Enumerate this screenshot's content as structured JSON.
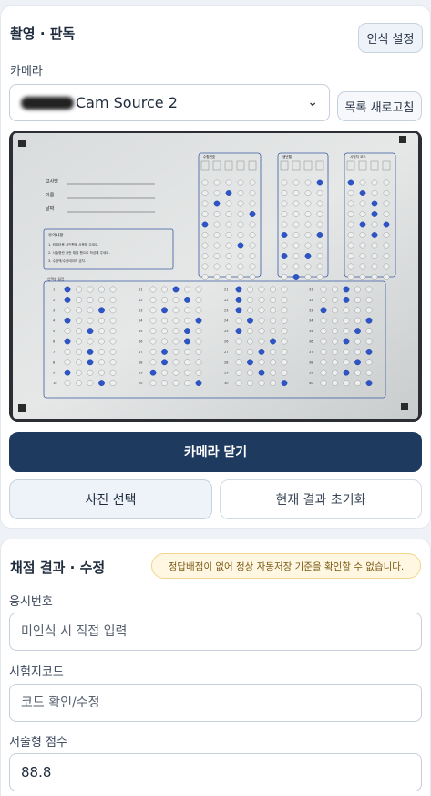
{
  "capture": {
    "title": "촬영 · 판독",
    "recognition_settings": "인식 설정",
    "camera_label": "카메라",
    "camera_selected": "Cam Source 2",
    "refresh_list": "목록 새로고침",
    "close_camera": "카메라 닫기",
    "select_photo": "사진 선택",
    "reset_result": "현재 결과 초기화"
  },
  "omr_sheet": {
    "fields": [
      "고사명",
      "이름",
      "날짜"
    ],
    "notice_title": "유의사항",
    "notice_lines": [
      "1. 컴퓨터용 사인펜을 사용해 주세요.",
      "2. 서술형란 공란 채울 펜으로 작성해 주세요.",
      "3. 수정액/수정테이프 금지."
    ],
    "answers_title": "선택형 답란",
    "section_titles": [
      "수험번호",
      "생년월",
      "시험지 코드"
    ]
  },
  "results": {
    "title": "채점 결과 · 수정",
    "warning": "정답배점이 없어 정상 자동저장 기준을 확인할 수 없습니다.",
    "exam_number_label": "응시번호",
    "exam_number_placeholder": "미인식 시 직접 입력",
    "exam_number_value": "",
    "exam_code_label": "시험지코드",
    "exam_code_placeholder": "코드 확인/수정",
    "exam_code_value": "",
    "essay_score_label": "서술형 점수",
    "essay_score_value": "88.8"
  }
}
